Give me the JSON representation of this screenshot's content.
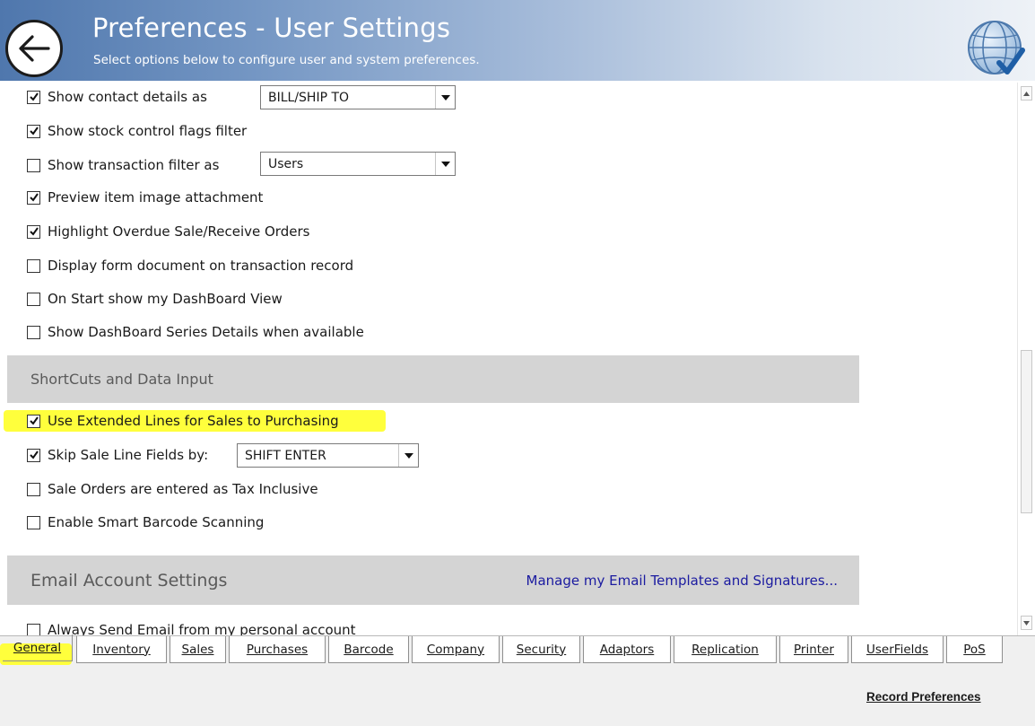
{
  "header": {
    "title": "Preferences - User Settings",
    "subtitle": "Select options below to configure user and system preferences."
  },
  "general_options": [
    {
      "label": "Show contact details as",
      "checked": true
    },
    {
      "label": "Show stock control flags filter",
      "checked": true
    },
    {
      "label": "Show transaction filter as",
      "checked": false
    },
    {
      "label": "Preview item image attachment",
      "checked": true
    },
    {
      "label": "Highlight Overdue Sale/Receive Orders",
      "checked": true
    },
    {
      "label": "Display form document on transaction record",
      "checked": false
    },
    {
      "label": "On Start show my DashBoard View",
      "checked": false
    },
    {
      "label": "Show DashBoard Series Details when available",
      "checked": false
    }
  ],
  "contact_details_select": {
    "value": "BILL/SHIP TO"
  },
  "transaction_filter_select": {
    "value": "Users"
  },
  "shortcuts": {
    "header": "ShortCuts and Data Input",
    "options": [
      {
        "label": "Use Extended Lines for Sales to Purchasing",
        "checked": true
      },
      {
        "label": "Skip Sale Line Fields by:",
        "checked": true
      },
      {
        "label": "Sale Orders are entered as Tax Inclusive",
        "checked": false
      },
      {
        "label": "Enable Smart Barcode Scanning",
        "checked": false
      }
    ],
    "skip_select": {
      "value": "SHIFT ENTER"
    }
  },
  "email": {
    "header": "Email Account Settings",
    "link": "Manage my Email Templates and Signatures...",
    "options": [
      {
        "label": "Always Send Email from my personal account",
        "checked": false
      }
    ]
  },
  "tabs": [
    {
      "label": "General"
    },
    {
      "label": "Inventory"
    },
    {
      "label": "Sales"
    },
    {
      "label": "Purchases"
    },
    {
      "label": "Barcode"
    },
    {
      "label": "Company"
    },
    {
      "label": "Security"
    },
    {
      "label": "Adaptors"
    },
    {
      "label": "Replication"
    },
    {
      "label": "Printer"
    },
    {
      "label": "UserFields"
    },
    {
      "label": "PoS"
    }
  ],
  "record_button": {
    "label": "Record Preferences"
  },
  "colors": {
    "header_start": "#4f77ad",
    "section_bg": "#d4d4d4",
    "highlight": "#ffff3c",
    "link": "#1b1ba0"
  }
}
